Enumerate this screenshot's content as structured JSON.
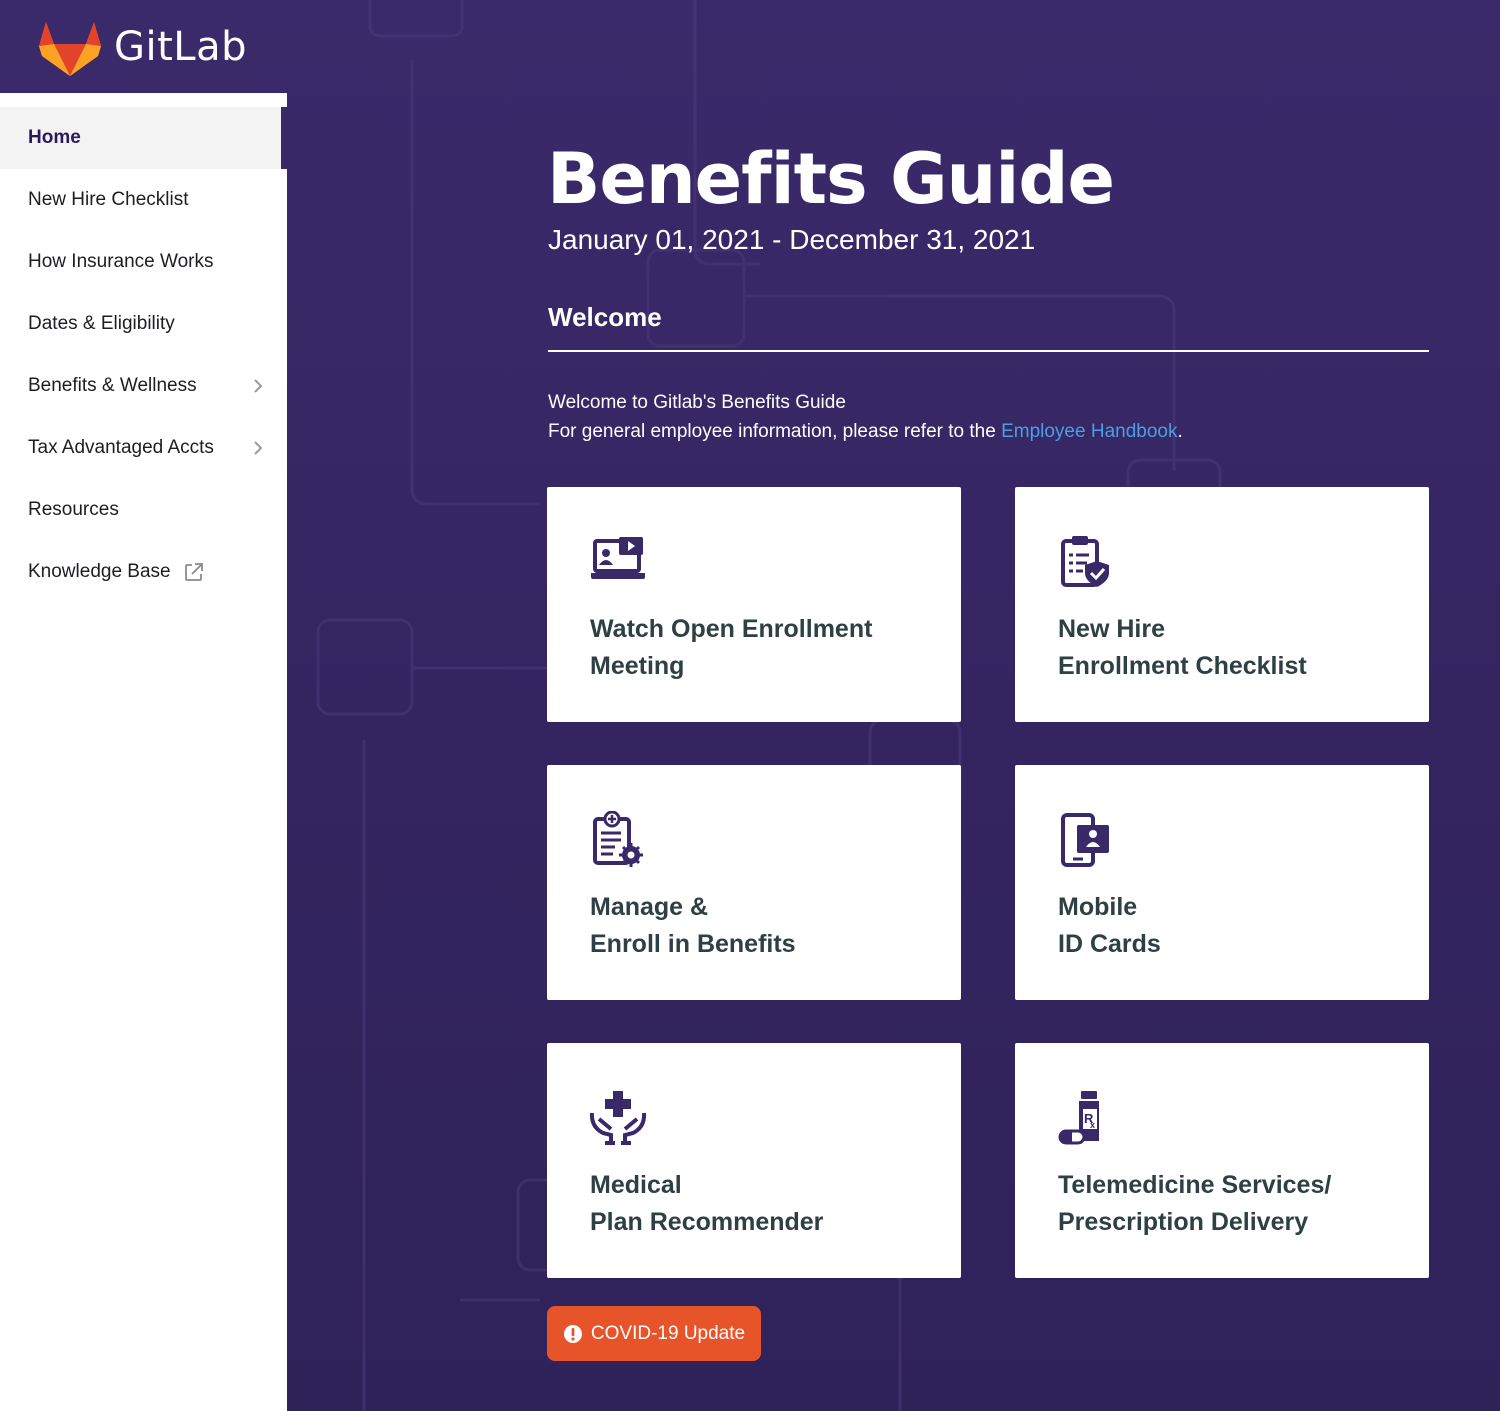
{
  "brand": {
    "name": "GitLab"
  },
  "sidebar": {
    "items": [
      {
        "label": "Home",
        "active": true
      },
      {
        "label": "New Hire Checklist"
      },
      {
        "label": "How Insurance Works"
      },
      {
        "label": "Dates & Eligibility"
      },
      {
        "label": "Benefits & Wellness",
        "has_submenu": true
      },
      {
        "label": "Tax Advantaged Accts",
        "has_submenu": true
      },
      {
        "label": "Resources"
      },
      {
        "label": "Knowledge Base",
        "external": true
      }
    ]
  },
  "main": {
    "title": "Benefits Guide",
    "date_range": "January 01, 2021 - December 31, 2021",
    "section_title": "Welcome",
    "intro_line1": "Welcome to Gitlab's Benefits Guide",
    "intro_line2_prefix": "For general employee information, please refer to the ",
    "intro_link": "Employee Handbook",
    "intro_line2_suffix": "."
  },
  "cards": [
    {
      "icon": "video-meeting-icon",
      "line1": "Watch Open Enrollment",
      "line2": "Meeting"
    },
    {
      "icon": "clipboard-check-icon",
      "line1": "New Hire",
      "line2": "Enrollment Checklist"
    },
    {
      "icon": "clipboard-gear-icon",
      "line1": "Manage &",
      "line2": "Enroll in Benefits"
    },
    {
      "icon": "mobile-id-icon",
      "line1": "Mobile",
      "line2": "ID Cards"
    },
    {
      "icon": "hands-medical-icon",
      "line1": "Medical",
      "line2": "Plan Recommender"
    },
    {
      "icon": "prescription-icon",
      "line1": "Telemedicine Services/",
      "line2": "Prescription Delivery"
    }
  ],
  "covid": {
    "label": "COVID-19 Update",
    "icon": "exclamation-circle-icon"
  },
  "colors": {
    "background": "#3a2968",
    "accent_orange": "#e8542a",
    "link_blue": "#4a9fe0",
    "card_text": "#2f4044",
    "icon_purple": "#3a2968"
  }
}
